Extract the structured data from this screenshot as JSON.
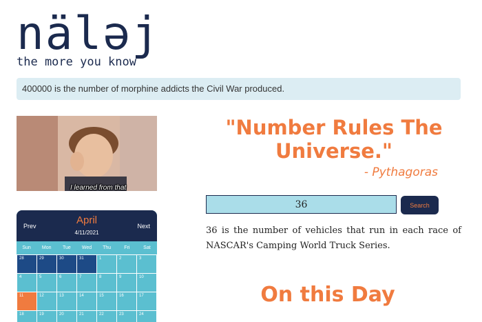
{
  "logo": {
    "word": "nälǝj",
    "tagline": "the more you know"
  },
  "fact_banner": {
    "text": "400000 is the number of morphine addicts the Civil War produced."
  },
  "hero_image": {
    "caption": "I learned from that"
  },
  "calendar": {
    "prev_label": "Prev",
    "next_label": "Next",
    "month": "April",
    "date": "4/11/2021",
    "weekdays": [
      "Sun",
      "Mon",
      "Tue",
      "Wed",
      "Thu",
      "Fri",
      "Sat"
    ],
    "days": [
      {
        "label": "28",
        "kind": "prev-month"
      },
      {
        "label": "29",
        "kind": "prev-month"
      },
      {
        "label": "30",
        "kind": "prev-month"
      },
      {
        "label": "31",
        "kind": "prev-month"
      },
      {
        "label": "1",
        "kind": ""
      },
      {
        "label": "2",
        "kind": ""
      },
      {
        "label": "3",
        "kind": ""
      },
      {
        "label": "4",
        "kind": ""
      },
      {
        "label": "5",
        "kind": ""
      },
      {
        "label": "6",
        "kind": ""
      },
      {
        "label": "7",
        "kind": ""
      },
      {
        "label": "8",
        "kind": ""
      },
      {
        "label": "9",
        "kind": ""
      },
      {
        "label": "10",
        "kind": ""
      },
      {
        "label": "11",
        "kind": "today"
      },
      {
        "label": "12",
        "kind": ""
      },
      {
        "label": "13",
        "kind": ""
      },
      {
        "label": "14",
        "kind": ""
      },
      {
        "label": "15",
        "kind": ""
      },
      {
        "label": "16",
        "kind": ""
      },
      {
        "label": "17",
        "kind": ""
      },
      {
        "label": "18",
        "kind": ""
      },
      {
        "label": "19",
        "kind": ""
      },
      {
        "label": "20",
        "kind": ""
      },
      {
        "label": "21",
        "kind": ""
      },
      {
        "label": "22",
        "kind": ""
      },
      {
        "label": "23",
        "kind": ""
      },
      {
        "label": "24",
        "kind": ""
      }
    ]
  },
  "quote": {
    "text": "\"Number Rules The Universe.\"",
    "author": "- Pythagoras"
  },
  "search": {
    "value": "36",
    "button_label": "Search"
  },
  "result": {
    "text": "36 is the number of vehicles that run in each race of NASCAR's Camping World Truck Series."
  },
  "section": {
    "title": "On this Day"
  },
  "colors": {
    "navy": "#1b2a4e",
    "orange": "#f07b3f",
    "teal": "#5bbfd0",
    "light_blue": "#aadde9",
    "banner": "#dcedf3"
  }
}
